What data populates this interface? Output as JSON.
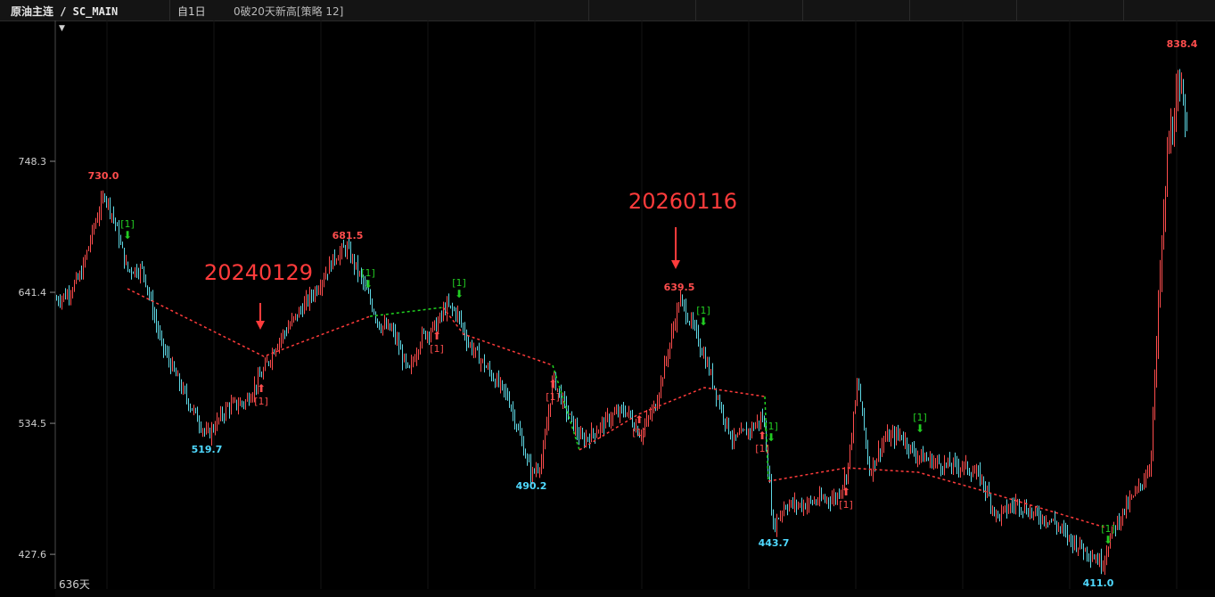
{
  "header": {
    "symbol": "原油主连 / SC_MAIN",
    "period": "自1日",
    "strategy": "0破20天新高[策略 12]"
  },
  "footer": {
    "bar_count": "636天"
  },
  "colors": {
    "up": "#ff4d4d",
    "down": "#5fd9e6",
    "buy_signal": "#22cc22",
    "sell_signal": "#ff4d4d",
    "trend_line": "#ff3b3b",
    "trend_line_alt": "#20d420",
    "high_label": "#ff4d4d",
    "low_label": "#4fd9ff"
  },
  "chart_data": {
    "type": "candlestick",
    "y_ticks": [
      "748.3",
      "641.4",
      "534.5",
      "427.6"
    ],
    "ylim": [
      412,
      850
    ],
    "bars": 636,
    "swing_labels": [
      {
        "text": "730.0",
        "kind": "high",
        "bar": 58,
        "value": 730.0
      },
      {
        "text": "519.7",
        "kind": "low",
        "bar": 175,
        "value": 519.7
      },
      {
        "text": "681.5",
        "kind": "high",
        "bar": 337,
        "value": 681.5
      },
      {
        "text": "490.2",
        "kind": "low",
        "bar": 560,
        "value": 490.2
      },
      {
        "text": "639.5",
        "kind": "high",
        "bar": 731,
        "value": 639.5
      },
      {
        "text": "443.7",
        "kind": "low",
        "bar": 862,
        "value": 443.7
      },
      {
        "text": "411.0",
        "kind": "low",
        "bar": 1237,
        "value": 411.0
      },
      {
        "text": "838.4",
        "kind": "high",
        "bar": 1322,
        "value": 838.4
      }
    ],
    "date_annotations": [
      {
        "text": "20240129",
        "value": 608
      },
      {
        "text": "20260116",
        "value": 656
      }
    ],
    "signal_label": "[1]"
  }
}
